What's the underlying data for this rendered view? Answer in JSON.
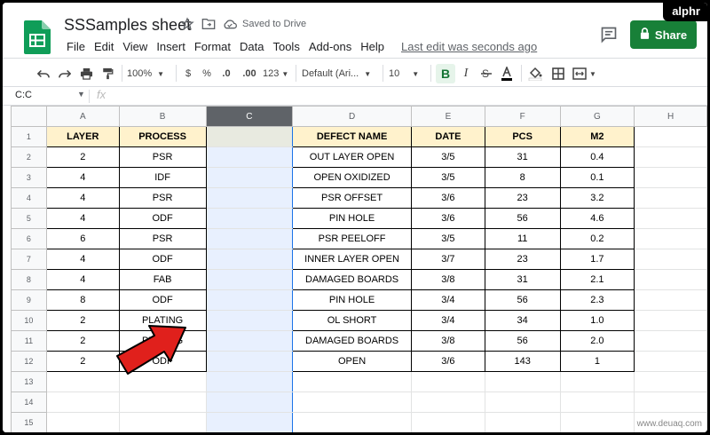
{
  "brand_badge": "alphr",
  "doc": {
    "title": "SSSamples sheet",
    "saved_status": "Saved to Drive",
    "last_edit": "Last edit was seconds ago"
  },
  "menu": [
    "File",
    "Edit",
    "View",
    "Insert",
    "Format",
    "Data",
    "Tools",
    "Add-ons",
    "Help"
  ],
  "share_label": "Share",
  "toolbar": {
    "zoom": "100%",
    "currency": "$",
    "percent": "%",
    "dec_decrease": ".0",
    "dec_increase": ".00",
    "more_formats": "123",
    "font": "Default (Ari...",
    "font_size": "10",
    "bold": "B"
  },
  "formula_bar": {
    "name_box": "C:C",
    "fx": "fx"
  },
  "grid": {
    "columns": [
      "A",
      "B",
      "C",
      "D",
      "E",
      "F",
      "G",
      "H"
    ],
    "selected_column": "C",
    "header_row": [
      "LAYER",
      "PROCESS",
      "",
      "DEFECT NAME",
      "DATE",
      "PCS",
      "M2"
    ],
    "rows": [
      [
        "2",
        "PSR",
        "",
        "OUT LAYER OPEN",
        "3/5",
        "31",
        "0.4"
      ],
      [
        "4",
        "IDF",
        "",
        "OPEN OXIDIZED",
        "3/5",
        "8",
        "0.1"
      ],
      [
        "4",
        "PSR",
        "",
        "PSR OFFSET",
        "3/6",
        "23",
        "3.2"
      ],
      [
        "4",
        "ODF",
        "",
        "PIN HOLE",
        "3/6",
        "56",
        "4.6"
      ],
      [
        "6",
        "PSR",
        "",
        "PSR PEELOFF",
        "3/5",
        "11",
        "0.2"
      ],
      [
        "4",
        "ODF",
        "",
        "INNER LAYER OPEN",
        "3/7",
        "23",
        "1.7"
      ],
      [
        "4",
        "FAB",
        "",
        "DAMAGED BOARDS",
        "3/8",
        "31",
        "2.1"
      ],
      [
        "8",
        "ODF",
        "",
        "PIN HOLE",
        "3/4",
        "56",
        "2.3"
      ],
      [
        "2",
        "PLATING",
        "",
        "OL SHORT",
        "3/4",
        "34",
        "1.0"
      ],
      [
        "2",
        "PLATING",
        "",
        "DAMAGED BOARDS",
        "3/8",
        "56",
        "2.0"
      ],
      [
        "2",
        "ODF",
        "",
        "OPEN",
        "3/6",
        "143",
        "1"
      ]
    ],
    "row_numbers": [
      "1",
      "2",
      "3",
      "4",
      "5",
      "6",
      "7",
      "8",
      "9",
      "10",
      "11",
      "12",
      "13",
      "14",
      "15"
    ]
  },
  "watermark": "www.deuaq.com",
  "colors": {
    "share_green": "#188038",
    "header_fill": "#fff2cc",
    "selection_blue": "#e8f0fe",
    "arrow_red": "#e0201c"
  }
}
